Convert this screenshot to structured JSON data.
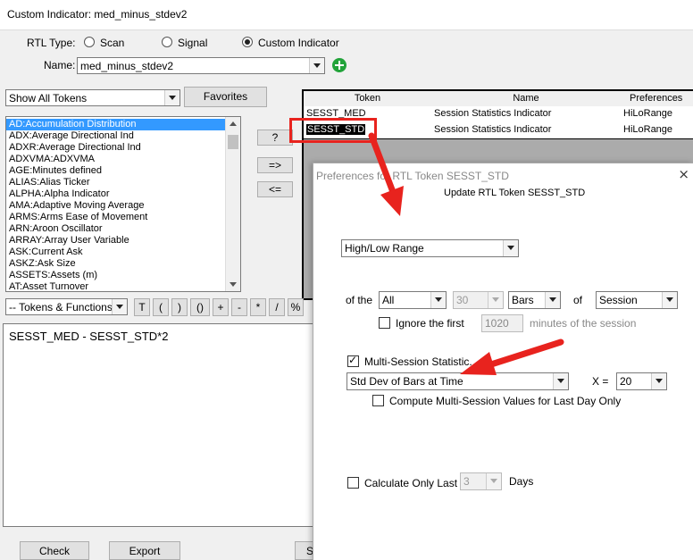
{
  "window": {
    "title": "Custom Indicator: med_minus_stdev2"
  },
  "rtl_type": {
    "label": "RTL Type:",
    "options": [
      "Scan",
      "Signal",
      "Custom Indicator"
    ],
    "selected": "Custom Indicator"
  },
  "name_field": {
    "label": "Name:",
    "value": "med_minus_stdev2"
  },
  "token_filter": {
    "value": "Show All Tokens"
  },
  "favorites_label": "Favorites",
  "token_list": [
    "AD:Accumulation Distribution",
    "ADX:Average Directional Ind",
    "ADXR:Average Directional Ind",
    "ADXVMA:ADXVMA",
    "AGE:Minutes defined",
    "ALIAS:Alias Ticker",
    "ALPHA:Alpha Indicator",
    "AMA:Adaptive Moving Average",
    "ARMS:Arms Ease of Movement",
    "ARN:Aroon Oscillator",
    "ARRAY:Array User Variable",
    "ASK:Current Ask",
    "ASKZ:Ask Size",
    "ASSETS:Assets (m)",
    "AT:Asset Turnover"
  ],
  "selected_token": "AD:Accumulation Distribution",
  "mid_buttons": {
    "help": "?",
    "add": "=>",
    "remove": "<="
  },
  "grid": {
    "headers": [
      "Token",
      "Name",
      "Preferences"
    ],
    "rows": [
      [
        "SESST_MED",
        "Session Statistics Indicator",
        "HiLoRange"
      ],
      [
        "SESST_STD",
        "Session Statistics Indicator",
        "HiLoRange"
      ]
    ]
  },
  "functions_combo": "-- Tokens & Functions --",
  "operators": [
    "T",
    "(",
    ")",
    "()",
    "+",
    "-",
    "*",
    "/",
    "%"
  ],
  "formula": "SESST_MED - SESST_STD*2",
  "bottom_buttons": {
    "check": "Check",
    "export": "Export",
    "partial": "S"
  },
  "prefs": {
    "title": "Preferences for RTL Token SESST_STD",
    "heading": "Update RTL Token SESST_STD",
    "statistic": "High/Low Range",
    "of_the_label": "of the",
    "bars_scope": "All",
    "bars_count": "30",
    "bars_unit": "Bars",
    "of_label": "of",
    "period": "Session",
    "ignore_label": "Ignore the first",
    "ignore_value": "1020",
    "ignore_suffix": "minutes of the session",
    "multi_label": "Multi-Session Statistic...",
    "multi_value": "Std Dev of Bars at Time",
    "x_label": "X =",
    "x_value": "20",
    "compute_label": "Compute Multi-Session Values for Last Day Only",
    "calc_label": "Calculate Only Last",
    "calc_value": "3",
    "days_label": "Days",
    "close_glyph": "×"
  },
  "colors": {
    "annotation_red": "#e8231e",
    "selection_blue": "#3399ff",
    "add_green": "#22a33a"
  }
}
